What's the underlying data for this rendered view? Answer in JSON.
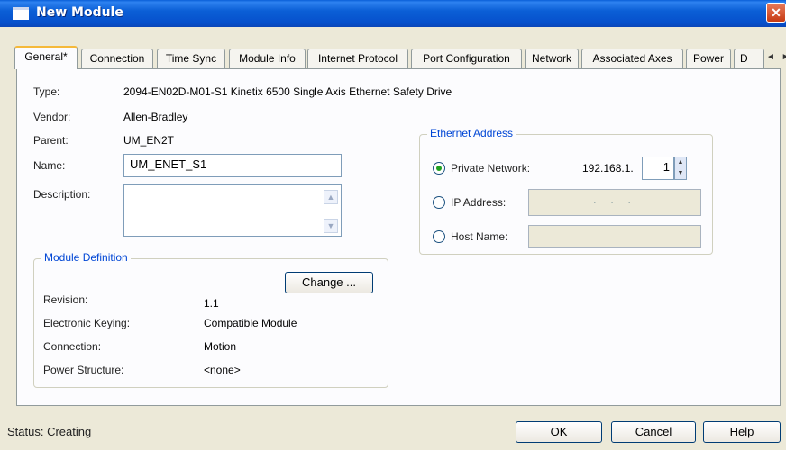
{
  "window": {
    "title": "New Module",
    "close": "✕"
  },
  "tabs": [
    {
      "label": "General*"
    },
    {
      "label": "Connection"
    },
    {
      "label": "Time Sync"
    },
    {
      "label": "Module Info"
    },
    {
      "label": "Internet Protocol"
    },
    {
      "label": "Port Configuration"
    },
    {
      "label": "Network"
    },
    {
      "label": "Associated Axes"
    },
    {
      "label": "Power"
    },
    {
      "label": "D"
    }
  ],
  "tab_scroll": {
    "left": "◄",
    "right": "►"
  },
  "general": {
    "type_label": "Type:",
    "type_value": "2094-EN02D-M01-S1 Kinetix 6500 Single Axis Ethernet Safety Drive",
    "vendor_label": "Vendor:",
    "vendor_value": "Allen-Bradley",
    "parent_label": "Parent:",
    "parent_value": "UM_EN2T",
    "name_label": "Name:",
    "name_value": "UM_ENET_S1",
    "description_label": "Description:",
    "description_value": ""
  },
  "module_definition": {
    "title": "Module Definition",
    "change_button": "Change ...",
    "revision_label": "Revision:",
    "revision_value": "1.1",
    "keying_label": "Electronic Keying:",
    "keying_value": "Compatible Module",
    "connection_label": "Connection:",
    "connection_value": "Motion",
    "power_label": "Power Structure:",
    "power_value": "<none>"
  },
  "ethernet": {
    "title": "Ethernet Address",
    "private_label": "Private Network:",
    "private_prefix": "192.168.1.",
    "private_octet": "1",
    "private_selected": true,
    "ip_label": "IP Address:",
    "ip_placeholder": ".   .   .",
    "host_label": "Host Name:",
    "host_value": ""
  },
  "footer": {
    "status": "Status:  Creating",
    "ok": "OK",
    "cancel": "Cancel",
    "help": "Help"
  }
}
